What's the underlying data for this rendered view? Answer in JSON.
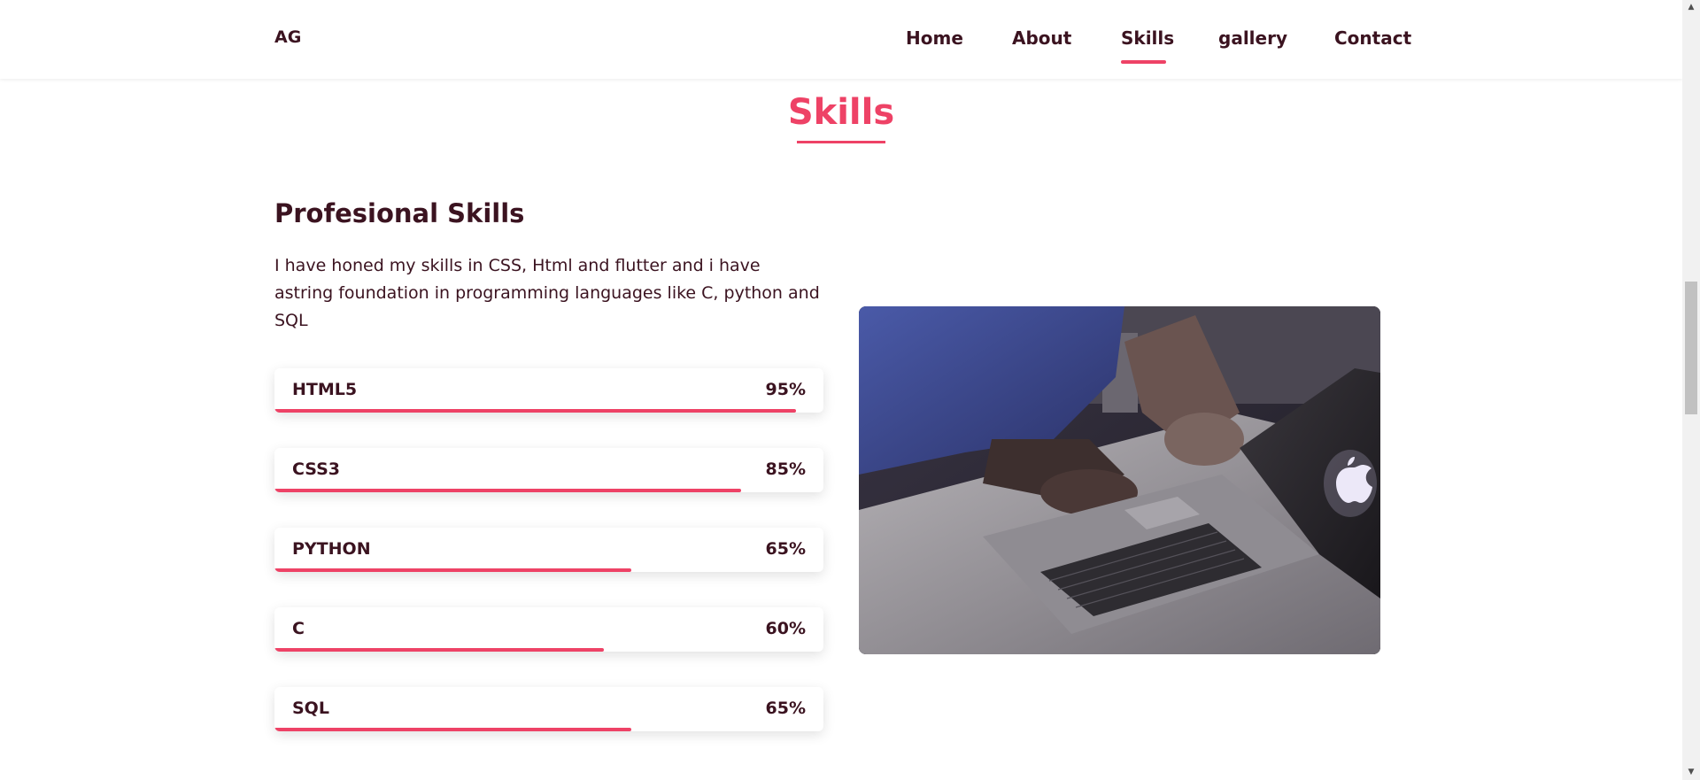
{
  "nav": {
    "logo": "AG",
    "links": [
      {
        "label": "Home",
        "active": false
      },
      {
        "label": "About",
        "active": false
      },
      {
        "label": "Skills",
        "active": true
      },
      {
        "label": "gallery",
        "active": false
      },
      {
        "label": "Contact",
        "active": false
      }
    ]
  },
  "section": {
    "title": "Skills",
    "subheading": "Profesional Skills",
    "description": "I have honed my skills in CSS, Html and flutter and i have astring foundation in programming languages like C, python and SQL"
  },
  "skills": [
    {
      "name": "HTML5",
      "percent_label": "95%",
      "level": 95
    },
    {
      "name": "CSS3",
      "percent_label": "85%",
      "level": 85
    },
    {
      "name": "PYTHON",
      "percent_label": "65%",
      "level": 65
    },
    {
      "name": "C",
      "percent_label": "60%",
      "level": 60
    },
    {
      "name": "SQL",
      "percent_label": "65%",
      "level": 65
    }
  ],
  "image": {
    "icon": "laptop-photo"
  },
  "colors": {
    "accent": "#ee4266",
    "text": "#3b1320",
    "background": "#ffffff"
  }
}
